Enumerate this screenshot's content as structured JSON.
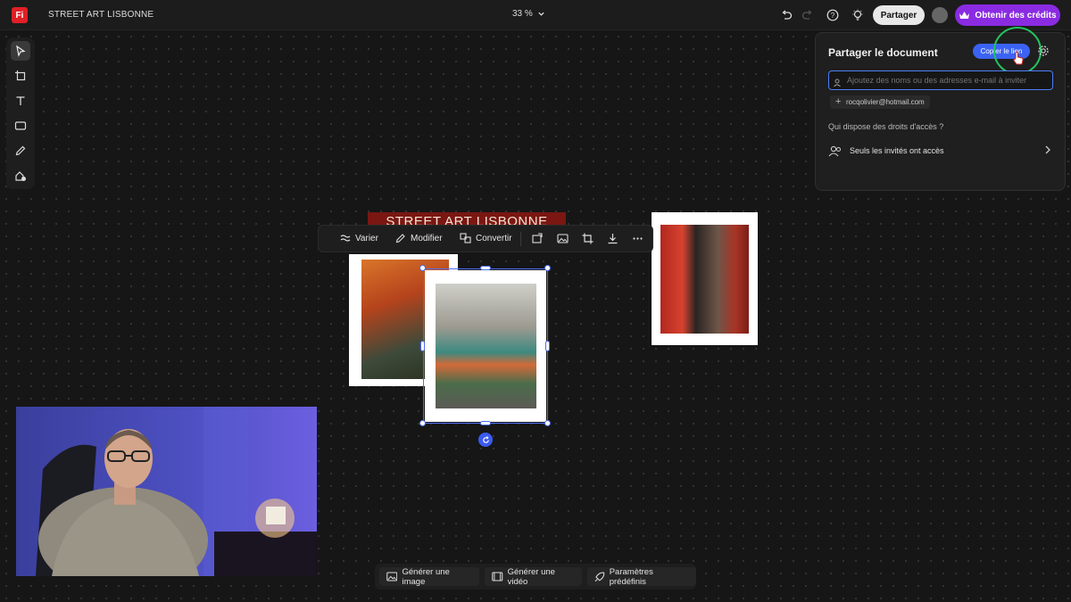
{
  "app": {
    "logo_text": "Fi",
    "document_title": "STREET ART LISBONNE",
    "zoom": "33 %",
    "share_label": "Partager",
    "credits_label": "Obtenir des crédits",
    "accent": "#8a2be2"
  },
  "toolbar": {
    "tools": [
      "select-icon",
      "frame-icon",
      "text-icon",
      "rectangle-icon",
      "pen-icon",
      "shapes-icon"
    ]
  },
  "share_panel": {
    "title": "Partager le document",
    "copy_link_label": "Copier le lien",
    "invite_placeholder": "Ajoutez des noms ou des adresses e-mail à inviter",
    "email_chip": "rocqolivier@hotmail.com",
    "access_question": "Qui dispose des droits d'accès ?",
    "access_setting": "Seuls les invités ont accès"
  },
  "canvas": {
    "banner_text": "STREET ART LISBONNE"
  },
  "context_toolbar": {
    "vary": "Varier",
    "modify": "Modifier",
    "convert": "Convertir"
  },
  "bottom_bar": {
    "generate_image": "Générer une image",
    "generate_video": "Générer une vidéo",
    "presets": "Paramètres prédéfinis"
  }
}
